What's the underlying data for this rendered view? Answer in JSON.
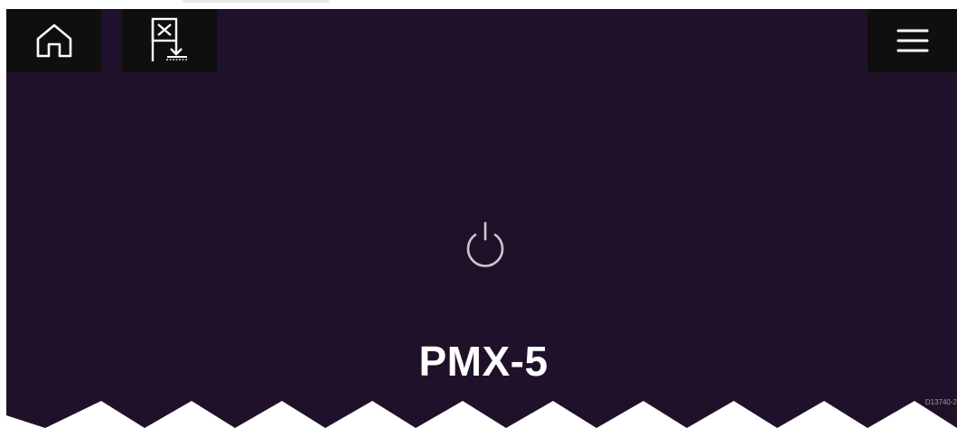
{
  "app": {
    "device_name": "PMX-5",
    "reference_code": "D13740-2"
  },
  "toolbar": {
    "home_icon": "home-icon",
    "waypoint_icon": "mob-waypoint-icon",
    "menu_icon": "hamburger-menu-icon"
  },
  "status": {
    "icon": "power-icon"
  },
  "colors": {
    "screen_background": "#20112b",
    "button_background": "#0f0f0f",
    "icon_color": "#ffffff",
    "power_icon_color": "#c9c9c9"
  }
}
